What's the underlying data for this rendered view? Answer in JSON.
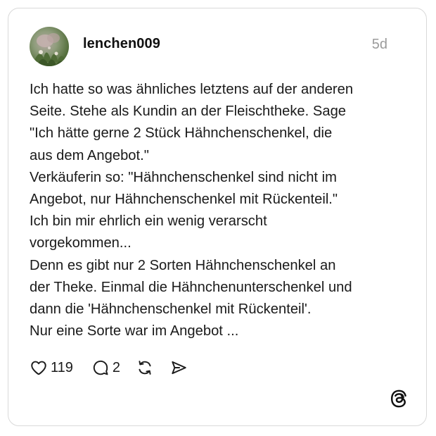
{
  "post": {
    "username": "lenchen009",
    "time": "5d",
    "lines": [
      "Ich hatte so was ähnliches letztens auf der anderen",
      "Seite. Stehe als Kundin an der Fleischtheke. Sage",
      "\"Ich hätte gerne 2 Stück Hähnchenschenkel, die",
      "aus dem Angebot.\"",
      "Verkäuferin so: \"Hähnchenschenkel sind nicht im",
      "Angebot, nur Hähnchenschenkel mit Rückenteil.\"",
      "Ich bin mir ehrlich ein wenig verarscht",
      "vorgekommen...",
      "Denn es gibt nur 2 Sorten Hähnchenschenkel an",
      "der Theke. Einmal die Hähnchenunterschenkel und",
      "dann die 'Hähnchenschenkel mit Rückenteil'.",
      "Nur eine Sorte war im Angebot ..."
    ]
  },
  "actions": {
    "likes": "119",
    "replies": "2",
    "like_icon": "heart-icon",
    "reply_icon": "speech-bubble-icon",
    "repost_icon": "repost-icon",
    "share_icon": "send-icon"
  },
  "brand": {
    "logo": "threads-logo-icon"
  }
}
